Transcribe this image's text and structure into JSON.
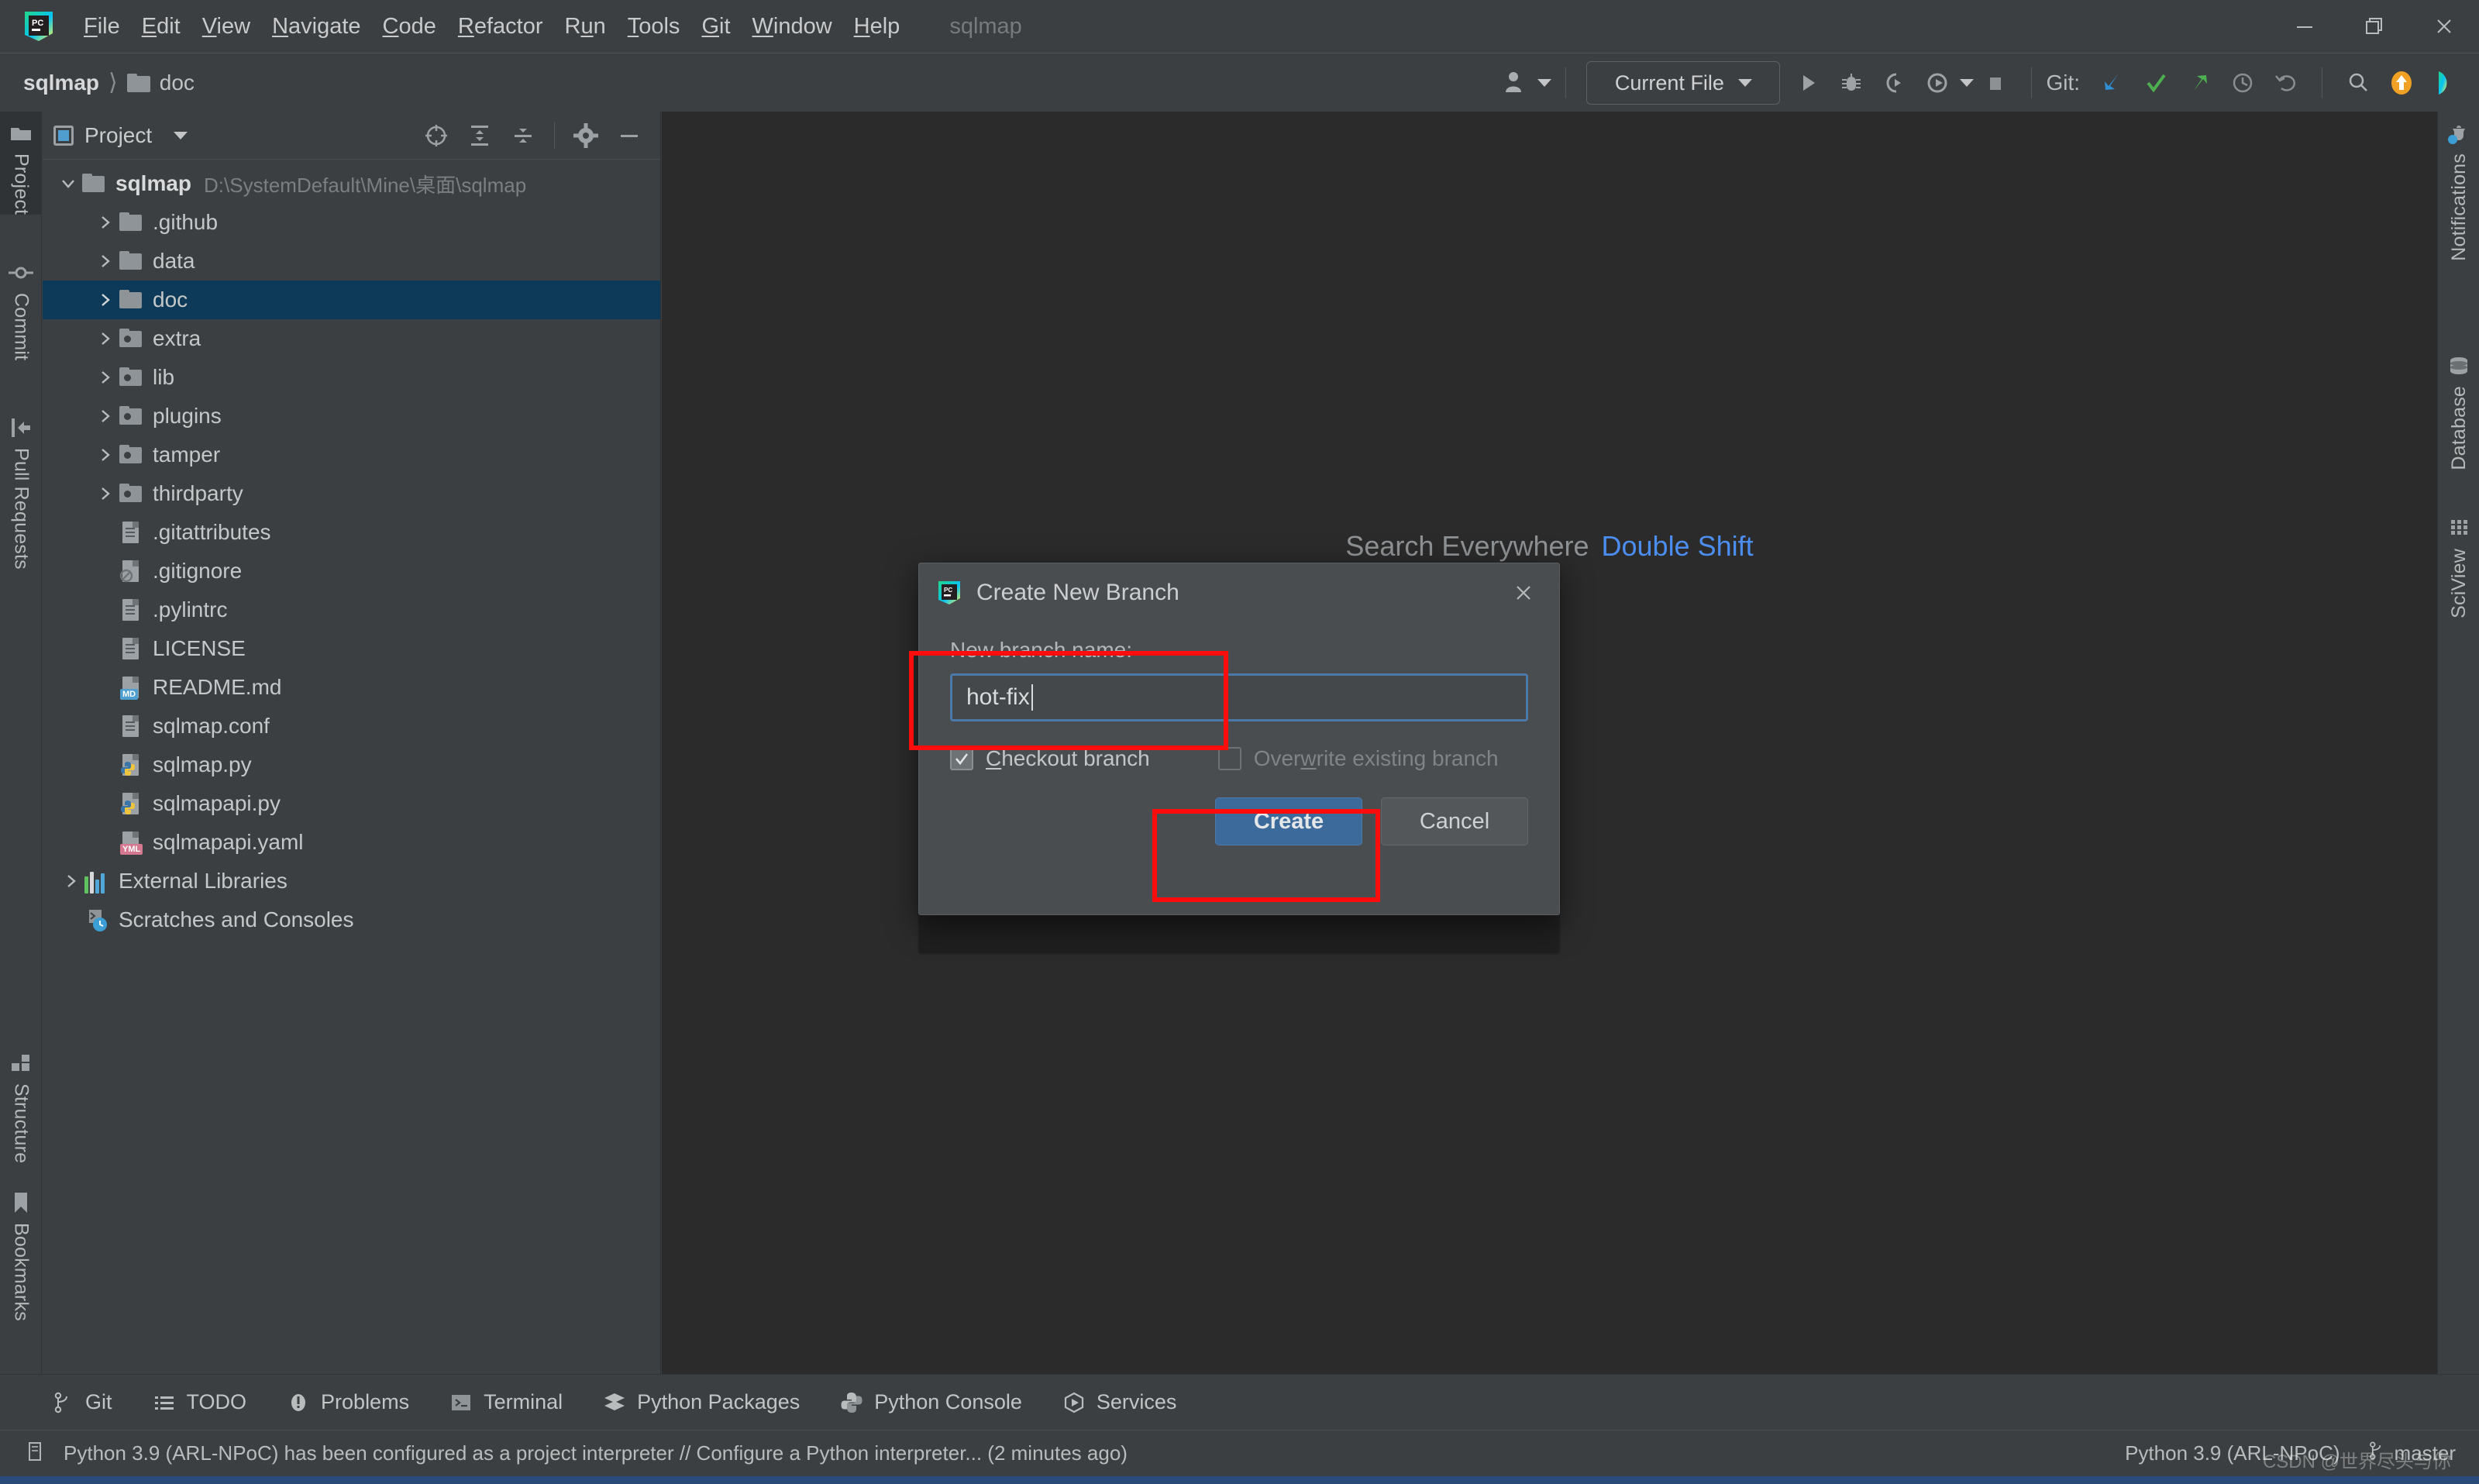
{
  "window": {
    "app_title": "sqlmap",
    "controls": {
      "minimize": "minimize-icon",
      "maximize": "maximize-icon",
      "close": "close-icon"
    }
  },
  "menubar": {
    "items": [
      {
        "label": "File",
        "mnemonic": "F"
      },
      {
        "label": "Edit",
        "mnemonic": "E"
      },
      {
        "label": "View",
        "mnemonic": "V"
      },
      {
        "label": "Navigate",
        "mnemonic": "N"
      },
      {
        "label": "Code",
        "mnemonic": "C"
      },
      {
        "label": "Refactor",
        "mnemonic": "R"
      },
      {
        "label": "Run",
        "mnemonic": "u"
      },
      {
        "label": "Tools",
        "mnemonic": "T"
      },
      {
        "label": "Git",
        "mnemonic": "G"
      },
      {
        "label": "Window",
        "mnemonic": "W"
      },
      {
        "label": "Help",
        "mnemonic": "H"
      }
    ]
  },
  "navbar": {
    "breadcrumb": [
      {
        "label": "sqlmap",
        "bold": true
      },
      {
        "label": "doc",
        "bold": false,
        "icon": "folder-icon"
      }
    ],
    "run_configuration": "Current File",
    "git_label": "Git:",
    "toolbar_icons": [
      "user-avatar-icon",
      "run-icon",
      "debug-icon",
      "run-coverage-icon",
      "profile-icon",
      "stop-icon",
      "git-update-icon",
      "git-commit-icon",
      "git-push-icon",
      "git-history-icon",
      "git-rollback-icon",
      "search-icon",
      "updates-icon",
      "ide-feedback-icon"
    ]
  },
  "left_stripe": {
    "tabs": [
      {
        "label": "Project",
        "icon": "project-folder-icon",
        "active": true
      },
      {
        "label": "Commit",
        "icon": "commit-icon",
        "active": false
      },
      {
        "label": "Pull Requests",
        "icon": "pull-request-icon",
        "active": false
      }
    ],
    "bottom_tabs": [
      {
        "label": "Structure",
        "icon": "structure-icon",
        "active": false
      },
      {
        "label": "Bookmarks",
        "icon": "bookmark-icon",
        "active": false
      }
    ]
  },
  "right_stripe": {
    "tabs": [
      {
        "label": "Notifications",
        "icon": "bell-icon",
        "badge": true
      },
      {
        "label": "Database",
        "icon": "database-icon",
        "badge": false
      },
      {
        "label": "SciView",
        "icon": "sciview-grid-icon",
        "badge": false
      }
    ]
  },
  "project_panel": {
    "title": "Project",
    "header_icons": [
      "select-opened-file-icon",
      "expand-all-icon",
      "collapse-all-icon",
      "settings-gear-icon",
      "hide-panel-icon"
    ],
    "tree": [
      {
        "label": "sqlmap",
        "path": "D:\\SystemDefault\\Mine\\桌面\\sqlmap",
        "indent": 0,
        "chevron": "down",
        "icon": "folder",
        "bold": true,
        "selected": false
      },
      {
        "label": ".github",
        "indent": 1,
        "chevron": "right",
        "icon": "folder",
        "selected": false
      },
      {
        "label": "data",
        "indent": 1,
        "chevron": "right",
        "icon": "folder",
        "selected": false
      },
      {
        "label": "doc",
        "indent": 1,
        "chevron": "right",
        "icon": "folder",
        "selected": true
      },
      {
        "label": "extra",
        "indent": 1,
        "chevron": "right",
        "icon": "folder-src",
        "selected": false
      },
      {
        "label": "lib",
        "indent": 1,
        "chevron": "right",
        "icon": "folder-src",
        "selected": false
      },
      {
        "label": "plugins",
        "indent": 1,
        "chevron": "right",
        "icon": "folder-src",
        "selected": false
      },
      {
        "label": "tamper",
        "indent": 1,
        "chevron": "right",
        "icon": "folder-src",
        "selected": false
      },
      {
        "label": "thirdparty",
        "indent": 1,
        "chevron": "right",
        "icon": "folder-src",
        "selected": false
      },
      {
        "label": ".gitattributes",
        "indent": 1,
        "chevron": "none",
        "icon": "file",
        "selected": false
      },
      {
        "label": ".gitignore",
        "indent": 1,
        "chevron": "none",
        "icon": "file-ignore",
        "selected": false
      },
      {
        "label": ".pylintrc",
        "indent": 1,
        "chevron": "none",
        "icon": "file",
        "selected": false
      },
      {
        "label": "LICENSE",
        "indent": 1,
        "chevron": "none",
        "icon": "file",
        "selected": false
      },
      {
        "label": "README.md",
        "indent": 1,
        "chevron": "none",
        "icon": "file-md",
        "selected": false
      },
      {
        "label": "sqlmap.conf",
        "indent": 1,
        "chevron": "none",
        "icon": "file",
        "selected": false
      },
      {
        "label": "sqlmap.py",
        "indent": 1,
        "chevron": "none",
        "icon": "file-py",
        "selected": false
      },
      {
        "label": "sqlmapapi.py",
        "indent": 1,
        "chevron": "none",
        "icon": "file-py",
        "selected": false
      },
      {
        "label": "sqlmapapi.yaml",
        "indent": 1,
        "chevron": "none",
        "icon": "file-yml",
        "selected": false
      },
      {
        "label": "External Libraries",
        "indent": 0,
        "chevron": "right",
        "icon": "libraries",
        "selected": false
      },
      {
        "label": "Scratches and Consoles",
        "indent": 0,
        "chevron": "none",
        "icon": "scratches",
        "selected": false
      }
    ]
  },
  "editor": {
    "hint_text": "Search Everywhere",
    "hint_shortcut": "Double Shift",
    "accent_blue": "#4b8ef0"
  },
  "dialog": {
    "title": "Create New Branch",
    "icon": "pycharm-logo-icon",
    "close_icon": "close-icon",
    "field_label": "New branch name:",
    "field_value": "hot-fix",
    "field_placeholder": "",
    "checkbox_checkout": {
      "label": "Checkout branch",
      "mnemonic": "C",
      "checked": true,
      "enabled": true
    },
    "checkbox_overwrite": {
      "label": "Overwrite existing branch",
      "mnemonic": "w",
      "checked": false,
      "enabled": false
    },
    "create_button": "Create",
    "cancel_button": "Cancel",
    "highlight_color": "#ff0d0d",
    "primary_color": "#3c6a9b"
  },
  "bottom_tabs": [
    {
      "label": "Git",
      "icon": "git-branch-icon"
    },
    {
      "label": "TODO",
      "icon": "todo-list-icon"
    },
    {
      "label": "Problems",
      "icon": "problems-icon"
    },
    {
      "label": "Terminal",
      "icon": "terminal-icon"
    },
    {
      "label": "Python Packages",
      "icon": "python-packages-icon"
    },
    {
      "label": "Python Console",
      "icon": "python-console-icon"
    },
    {
      "label": "Services",
      "icon": "services-icon"
    }
  ],
  "statusbar": {
    "message": "Python 3.9 (ARL-NPoC) has been configured as a project interpreter // Configure a Python interpreter... (2 minutes ago)",
    "message_icon": "event-log-icon",
    "interpreter": "Python 3.9 (ARL-NPoC)",
    "branch": "master",
    "branch_icon": "git-branch-icon"
  },
  "watermark": "CSDN @世界尽头与你"
}
